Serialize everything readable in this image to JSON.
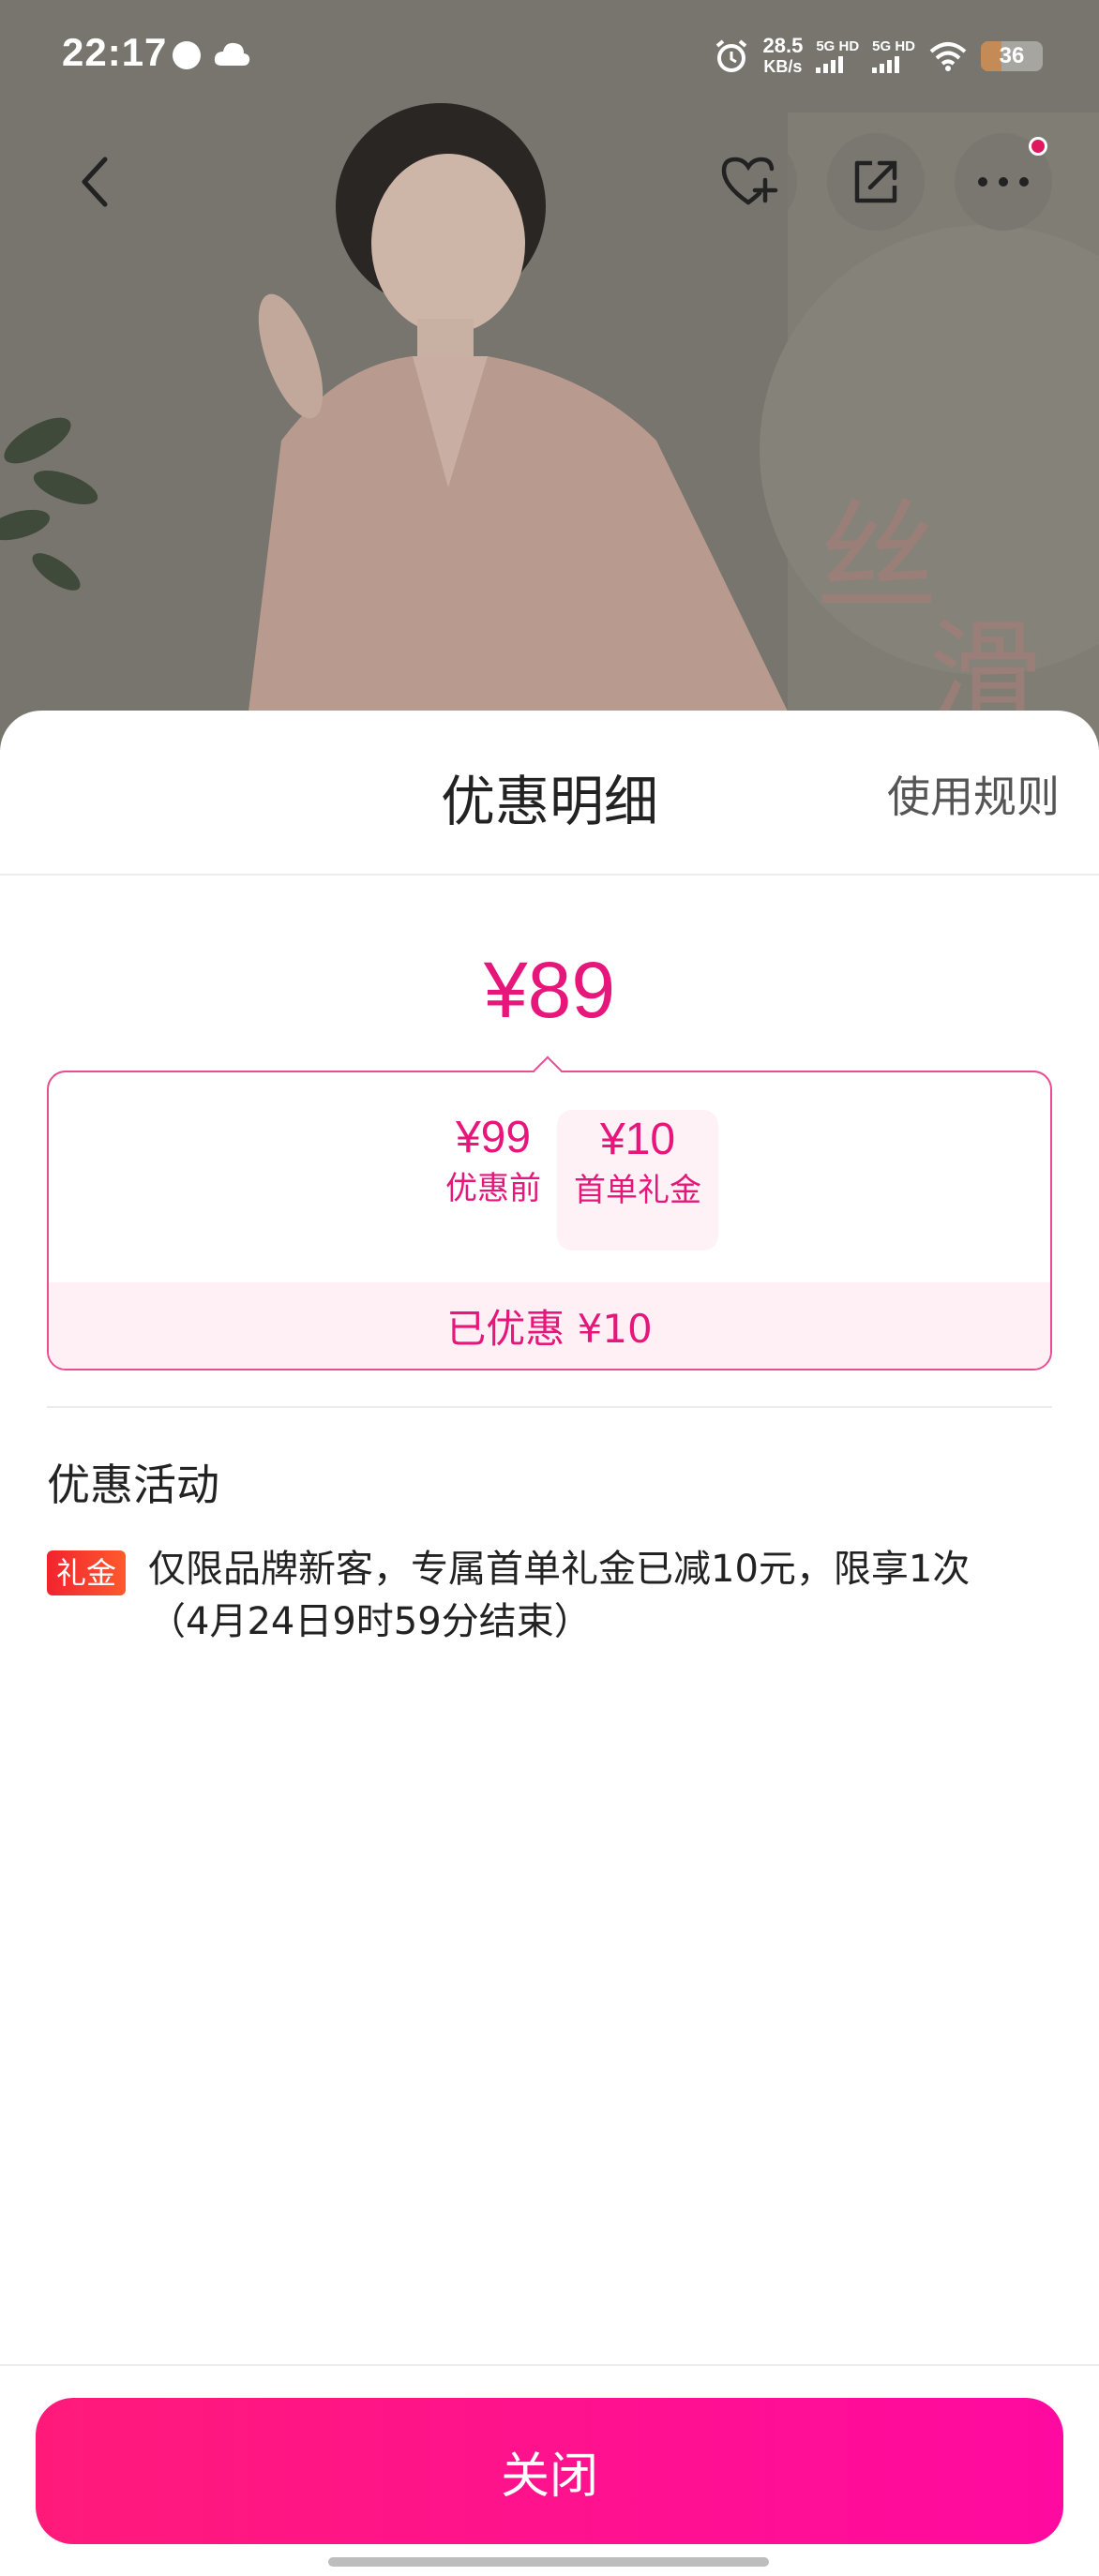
{
  "status_bar": {
    "time": "22:17",
    "net_speed_value": "28.5",
    "net_speed_unit": "KB/s",
    "signal1_label": "5G HD",
    "signal2_label": "5G HD",
    "battery_level": "36",
    "icons": [
      "notification-icon",
      "cloud-icon",
      "alarm-icon",
      "wifi-icon",
      "battery-icon"
    ]
  },
  "nav": {
    "icons": [
      "back-icon",
      "favorite-add-icon",
      "share-icon",
      "more-icon"
    ]
  },
  "sheet": {
    "title": "优惠明细",
    "rules_link": "使用规则",
    "final_price": "¥89",
    "before_amount": "¥99",
    "before_label": "优惠前",
    "minus": "-",
    "coupon_amount": "¥10",
    "coupon_label": "首单礼金",
    "saved_text": "已优惠 ¥10",
    "promo_section_title": "优惠活动",
    "promo_badge": "礼金",
    "promo_text": "仅限品牌新客，专属首单礼金已减10元，限享1次（4月24日9时59分结束）",
    "close_button": "关闭"
  },
  "colors": {
    "accent": "#e6167a",
    "button_gradient_start": "#ff1a7a",
    "button_gradient_end": "#ff0aa0",
    "badge": "#f2232f"
  }
}
